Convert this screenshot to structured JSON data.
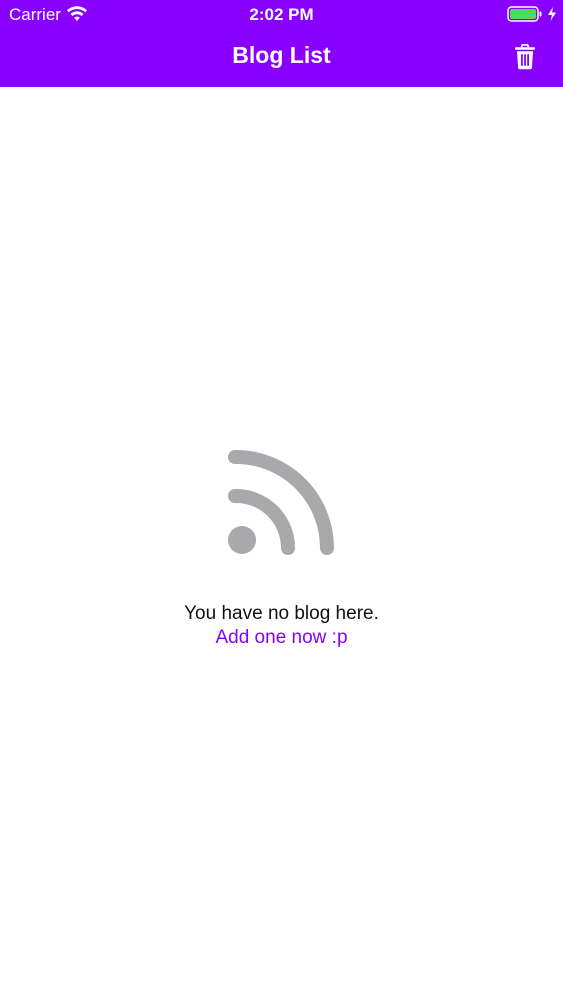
{
  "status_bar": {
    "carrier": "Carrier",
    "time": "2:02 PM",
    "wifi_icon": "wifi-icon",
    "battery_icon": "battery-full-icon",
    "charging_icon": "bolt-icon"
  },
  "nav_bar": {
    "title": "Blog List",
    "action_icon": "trash-icon",
    "background_color": "#8a00ff"
  },
  "empty_state": {
    "icon": "rss-icon",
    "icon_color": "#a9a9ab",
    "message": "You have no blog here.",
    "action_label": "Add one now :p",
    "action_color": "#8a00ff"
  }
}
